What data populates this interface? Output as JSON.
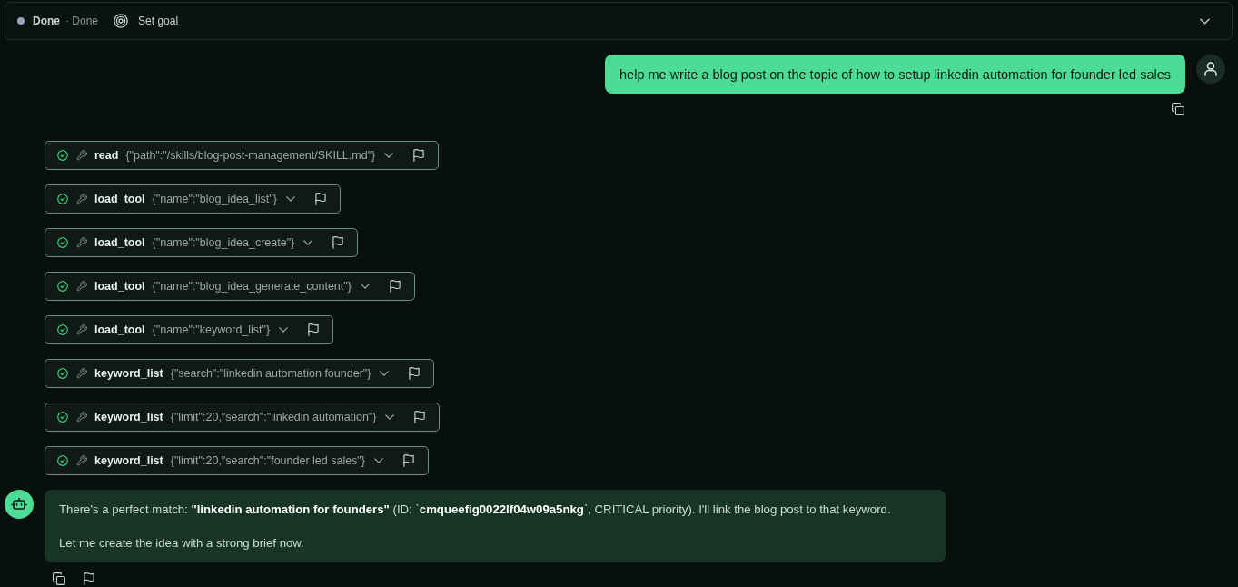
{
  "status_bar": {
    "state": "Done",
    "detail": "· Done",
    "goal_button": "Set goal",
    "expanded": false
  },
  "user_message": {
    "text": "help me write a blog post on the topic of how to setup linkedin automation for founder led sales"
  },
  "tool_calls": [
    {
      "name": "read",
      "args": "{\"path\":\"/skills/blog-post-management/SKILL.md\"}",
      "done": true
    },
    {
      "name": "load_tool",
      "args": "{\"name\":\"blog_idea_list\"}",
      "done": true
    },
    {
      "name": "load_tool",
      "args": "{\"name\":\"blog_idea_create\"}",
      "done": true
    },
    {
      "name": "load_tool",
      "args": "{\"name\":\"blog_idea_generate_content\"}",
      "done": true
    },
    {
      "name": "load_tool",
      "args": "{\"name\":\"keyword_list\"}",
      "done": true
    },
    {
      "name": "keyword_list",
      "args": "{\"search\":\"linkedin automation founder\"}",
      "done": true
    },
    {
      "name": "keyword_list",
      "args": "{\"limit\":20,\"search\":\"linkedin automation\"}",
      "done": true
    },
    {
      "name": "keyword_list",
      "args": "{\"limit\":20,\"search\":\"founder led sales\"}",
      "done": true
    }
  ],
  "assistant_message": {
    "paragraphs": [
      "There's a perfect match: **\"linkedin automation for founders\"** (ID: `**cmqueefig0022lf04w09a5nkg**`, CRITICAL priority). I'll link the blog post to that keyword.",
      "Let me create the idea with a strong brief now."
    ]
  }
}
